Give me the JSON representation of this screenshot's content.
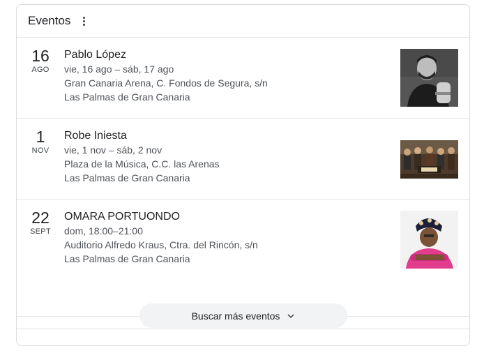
{
  "header": {
    "title": "Eventos",
    "menu_icon": "more-vert-icon"
  },
  "events": [
    {
      "day": "16",
      "month": "AGO",
      "title": "Pablo López",
      "dates": "vie, 16 ago – sáb, 17 ago",
      "venue": "Gran Canaria Arena, C. Fondos de Segura, s/n",
      "city": "Las Palmas de Gran Canaria",
      "image": "pablo-lopez-photo"
    },
    {
      "day": "1",
      "month": "NOV",
      "title": "Robe Iniesta",
      "dates": "vie, 1 nov – sáb, 2 nov",
      "venue": "Plaza de la Música, C.C. las Arenas",
      "city": "Las Palmas de Gran Canaria",
      "image": "robe-band-photo"
    },
    {
      "day": "22",
      "month": "SEPT",
      "title": "OMARA PORTUONDO",
      "dates": "dom, 18:00–21:00",
      "venue": "Auditorio Alfredo Kraus, Ctra. del Rincón, s/n",
      "city": "Las Palmas de Gran Canaria",
      "image": "omara-portuondo-photo"
    }
  ],
  "more_button": {
    "label": "Buscar más eventos",
    "icon": "chevron-down-icon"
  }
}
